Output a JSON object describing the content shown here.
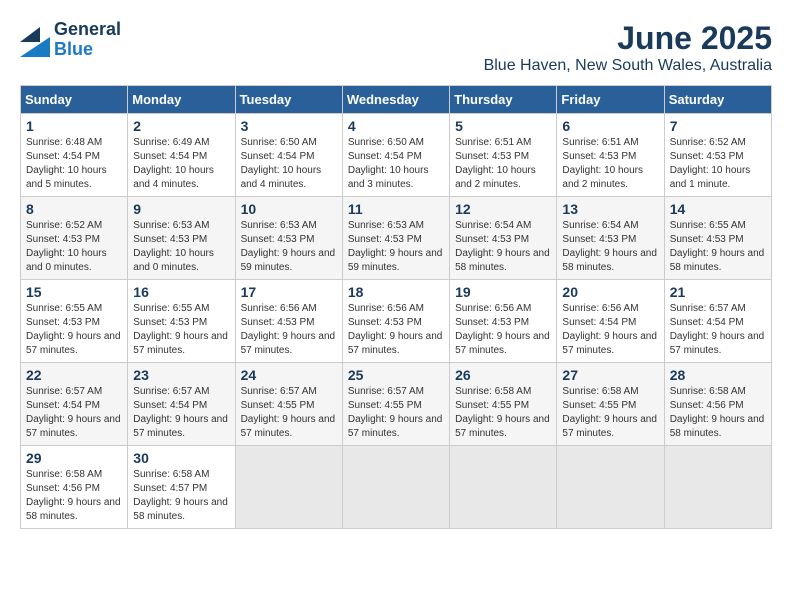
{
  "logo": {
    "text_general": "General",
    "text_blue": "Blue"
  },
  "header": {
    "month_year": "June 2025",
    "location": "Blue Haven, New South Wales, Australia"
  },
  "weekdays": [
    "Sunday",
    "Monday",
    "Tuesday",
    "Wednesday",
    "Thursday",
    "Friday",
    "Saturday"
  ],
  "weeks": [
    [
      {
        "day": "1",
        "sunrise": "6:48 AM",
        "sunset": "4:54 PM",
        "daylight": "10 hours and 5 minutes."
      },
      {
        "day": "2",
        "sunrise": "6:49 AM",
        "sunset": "4:54 PM",
        "daylight": "10 hours and 4 minutes."
      },
      {
        "day": "3",
        "sunrise": "6:50 AM",
        "sunset": "4:54 PM",
        "daylight": "10 hours and 4 minutes."
      },
      {
        "day": "4",
        "sunrise": "6:50 AM",
        "sunset": "4:54 PM",
        "daylight": "10 hours and 3 minutes."
      },
      {
        "day": "5",
        "sunrise": "6:51 AM",
        "sunset": "4:53 PM",
        "daylight": "10 hours and 2 minutes."
      },
      {
        "day": "6",
        "sunrise": "6:51 AM",
        "sunset": "4:53 PM",
        "daylight": "10 hours and 2 minutes."
      },
      {
        "day": "7",
        "sunrise": "6:52 AM",
        "sunset": "4:53 PM",
        "daylight": "10 hours and 1 minute."
      }
    ],
    [
      {
        "day": "8",
        "sunrise": "6:52 AM",
        "sunset": "4:53 PM",
        "daylight": "10 hours and 0 minutes."
      },
      {
        "day": "9",
        "sunrise": "6:53 AM",
        "sunset": "4:53 PM",
        "daylight": "10 hours and 0 minutes."
      },
      {
        "day": "10",
        "sunrise": "6:53 AM",
        "sunset": "4:53 PM",
        "daylight": "9 hours and 59 minutes."
      },
      {
        "day": "11",
        "sunrise": "6:53 AM",
        "sunset": "4:53 PM",
        "daylight": "9 hours and 59 minutes."
      },
      {
        "day": "12",
        "sunrise": "6:54 AM",
        "sunset": "4:53 PM",
        "daylight": "9 hours and 58 minutes."
      },
      {
        "day": "13",
        "sunrise": "6:54 AM",
        "sunset": "4:53 PM",
        "daylight": "9 hours and 58 minutes."
      },
      {
        "day": "14",
        "sunrise": "6:55 AM",
        "sunset": "4:53 PM",
        "daylight": "9 hours and 58 minutes."
      }
    ],
    [
      {
        "day": "15",
        "sunrise": "6:55 AM",
        "sunset": "4:53 PM",
        "daylight": "9 hours and 57 minutes."
      },
      {
        "day": "16",
        "sunrise": "6:55 AM",
        "sunset": "4:53 PM",
        "daylight": "9 hours and 57 minutes."
      },
      {
        "day": "17",
        "sunrise": "6:56 AM",
        "sunset": "4:53 PM",
        "daylight": "9 hours and 57 minutes."
      },
      {
        "day": "18",
        "sunrise": "6:56 AM",
        "sunset": "4:53 PM",
        "daylight": "9 hours and 57 minutes."
      },
      {
        "day": "19",
        "sunrise": "6:56 AM",
        "sunset": "4:53 PM",
        "daylight": "9 hours and 57 minutes."
      },
      {
        "day": "20",
        "sunrise": "6:56 AM",
        "sunset": "4:54 PM",
        "daylight": "9 hours and 57 minutes."
      },
      {
        "day": "21",
        "sunrise": "6:57 AM",
        "sunset": "4:54 PM",
        "daylight": "9 hours and 57 minutes."
      }
    ],
    [
      {
        "day": "22",
        "sunrise": "6:57 AM",
        "sunset": "4:54 PM",
        "daylight": "9 hours and 57 minutes."
      },
      {
        "day": "23",
        "sunrise": "6:57 AM",
        "sunset": "4:54 PM",
        "daylight": "9 hours and 57 minutes."
      },
      {
        "day": "24",
        "sunrise": "6:57 AM",
        "sunset": "4:55 PM",
        "daylight": "9 hours and 57 minutes."
      },
      {
        "day": "25",
        "sunrise": "6:57 AM",
        "sunset": "4:55 PM",
        "daylight": "9 hours and 57 minutes."
      },
      {
        "day": "26",
        "sunrise": "6:58 AM",
        "sunset": "4:55 PM",
        "daylight": "9 hours and 57 minutes."
      },
      {
        "day": "27",
        "sunrise": "6:58 AM",
        "sunset": "4:55 PM",
        "daylight": "9 hours and 57 minutes."
      },
      {
        "day": "28",
        "sunrise": "6:58 AM",
        "sunset": "4:56 PM",
        "daylight": "9 hours and 58 minutes."
      }
    ],
    [
      {
        "day": "29",
        "sunrise": "6:58 AM",
        "sunset": "4:56 PM",
        "daylight": "9 hours and 58 minutes."
      },
      {
        "day": "30",
        "sunrise": "6:58 AM",
        "sunset": "4:57 PM",
        "daylight": "9 hours and 58 minutes."
      },
      null,
      null,
      null,
      null,
      null
    ]
  ]
}
